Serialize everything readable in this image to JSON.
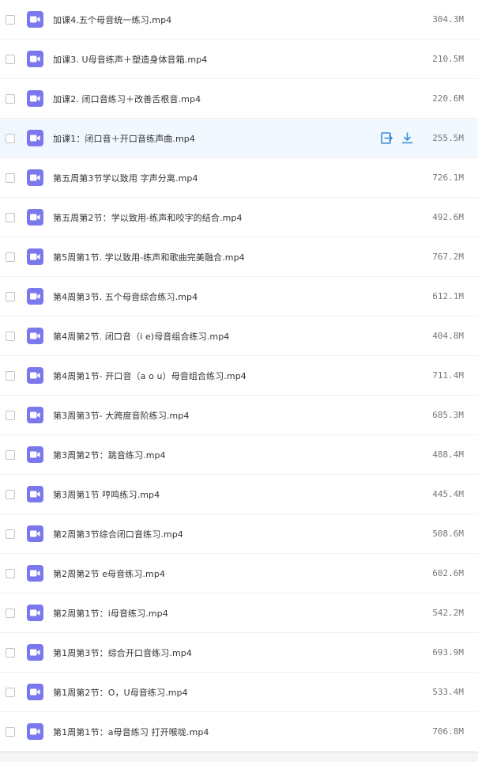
{
  "colors": {
    "video_icon": "#7b78ee",
    "hover_row": "#f1f8ff",
    "action_icon": "#3b8cd9",
    "size_text": "#777777"
  },
  "icons": {
    "file_type": "video-file-icon",
    "row_action_1": "open-in-icon",
    "row_action_2": "download-icon"
  },
  "hovered_row_index": 3,
  "files": [
    {
      "name": "加课4.五个母音统一练习.mp4",
      "size": "304.3M"
    },
    {
      "name": "加课3. U母音练声＋塑造身体音箱.mp4",
      "size": "210.5M"
    },
    {
      "name": "加课2. 闭口音练习＋改善舌根音.mp4",
      "size": "220.6M"
    },
    {
      "name": "加课1：闭口音＋开口音练声曲.mp4",
      "size": "255.5M"
    },
    {
      "name": "第五周第3节学以致用 字声分离.mp4",
      "size": "726.1M"
    },
    {
      "name": "第五周第2节：学以致用-练声和咬字的结合.mp4",
      "size": "492.6M"
    },
    {
      "name": "第5周第1节. 学以致用-练声和歌曲完美融合.mp4",
      "size": "767.2M"
    },
    {
      "name": "第4周第3节. 五个母音综合练习.mp4",
      "size": "612.1M"
    },
    {
      "name": "第4周第2节. 闭口音（i e)母音组合练习.mp4",
      "size": "404.8M"
    },
    {
      "name": "第4周第1节- 开口音（a o u）母音组合练习.mp4",
      "size": "711.4M"
    },
    {
      "name": "第3周第3节- 大跨度音阶练习.mp4",
      "size": "685.3M"
    },
    {
      "name": "第3周第2节：跳音练习.mp4",
      "size": "488.4M"
    },
    {
      "name": "第3周第1节 哼鸣练习.mp4",
      "size": "445.4M"
    },
    {
      "name": "第2周第3节综合闭口音练习.mp4",
      "size": "508.6M"
    },
    {
      "name": "第2周第2节 e母音练习.mp4",
      "size": "602.6M"
    },
    {
      "name": "第2周第1节：i母音练习.mp4",
      "size": "542.2M"
    },
    {
      "name": "第1周第3节：综合开口音练习.mp4",
      "size": "693.9M"
    },
    {
      "name": "第1周第2节：O，U母音练习.mp4",
      "size": "533.4M"
    },
    {
      "name": "第1周第1节：a母音练习 打开喉咙.mp4",
      "size": "706.8M"
    }
  ]
}
